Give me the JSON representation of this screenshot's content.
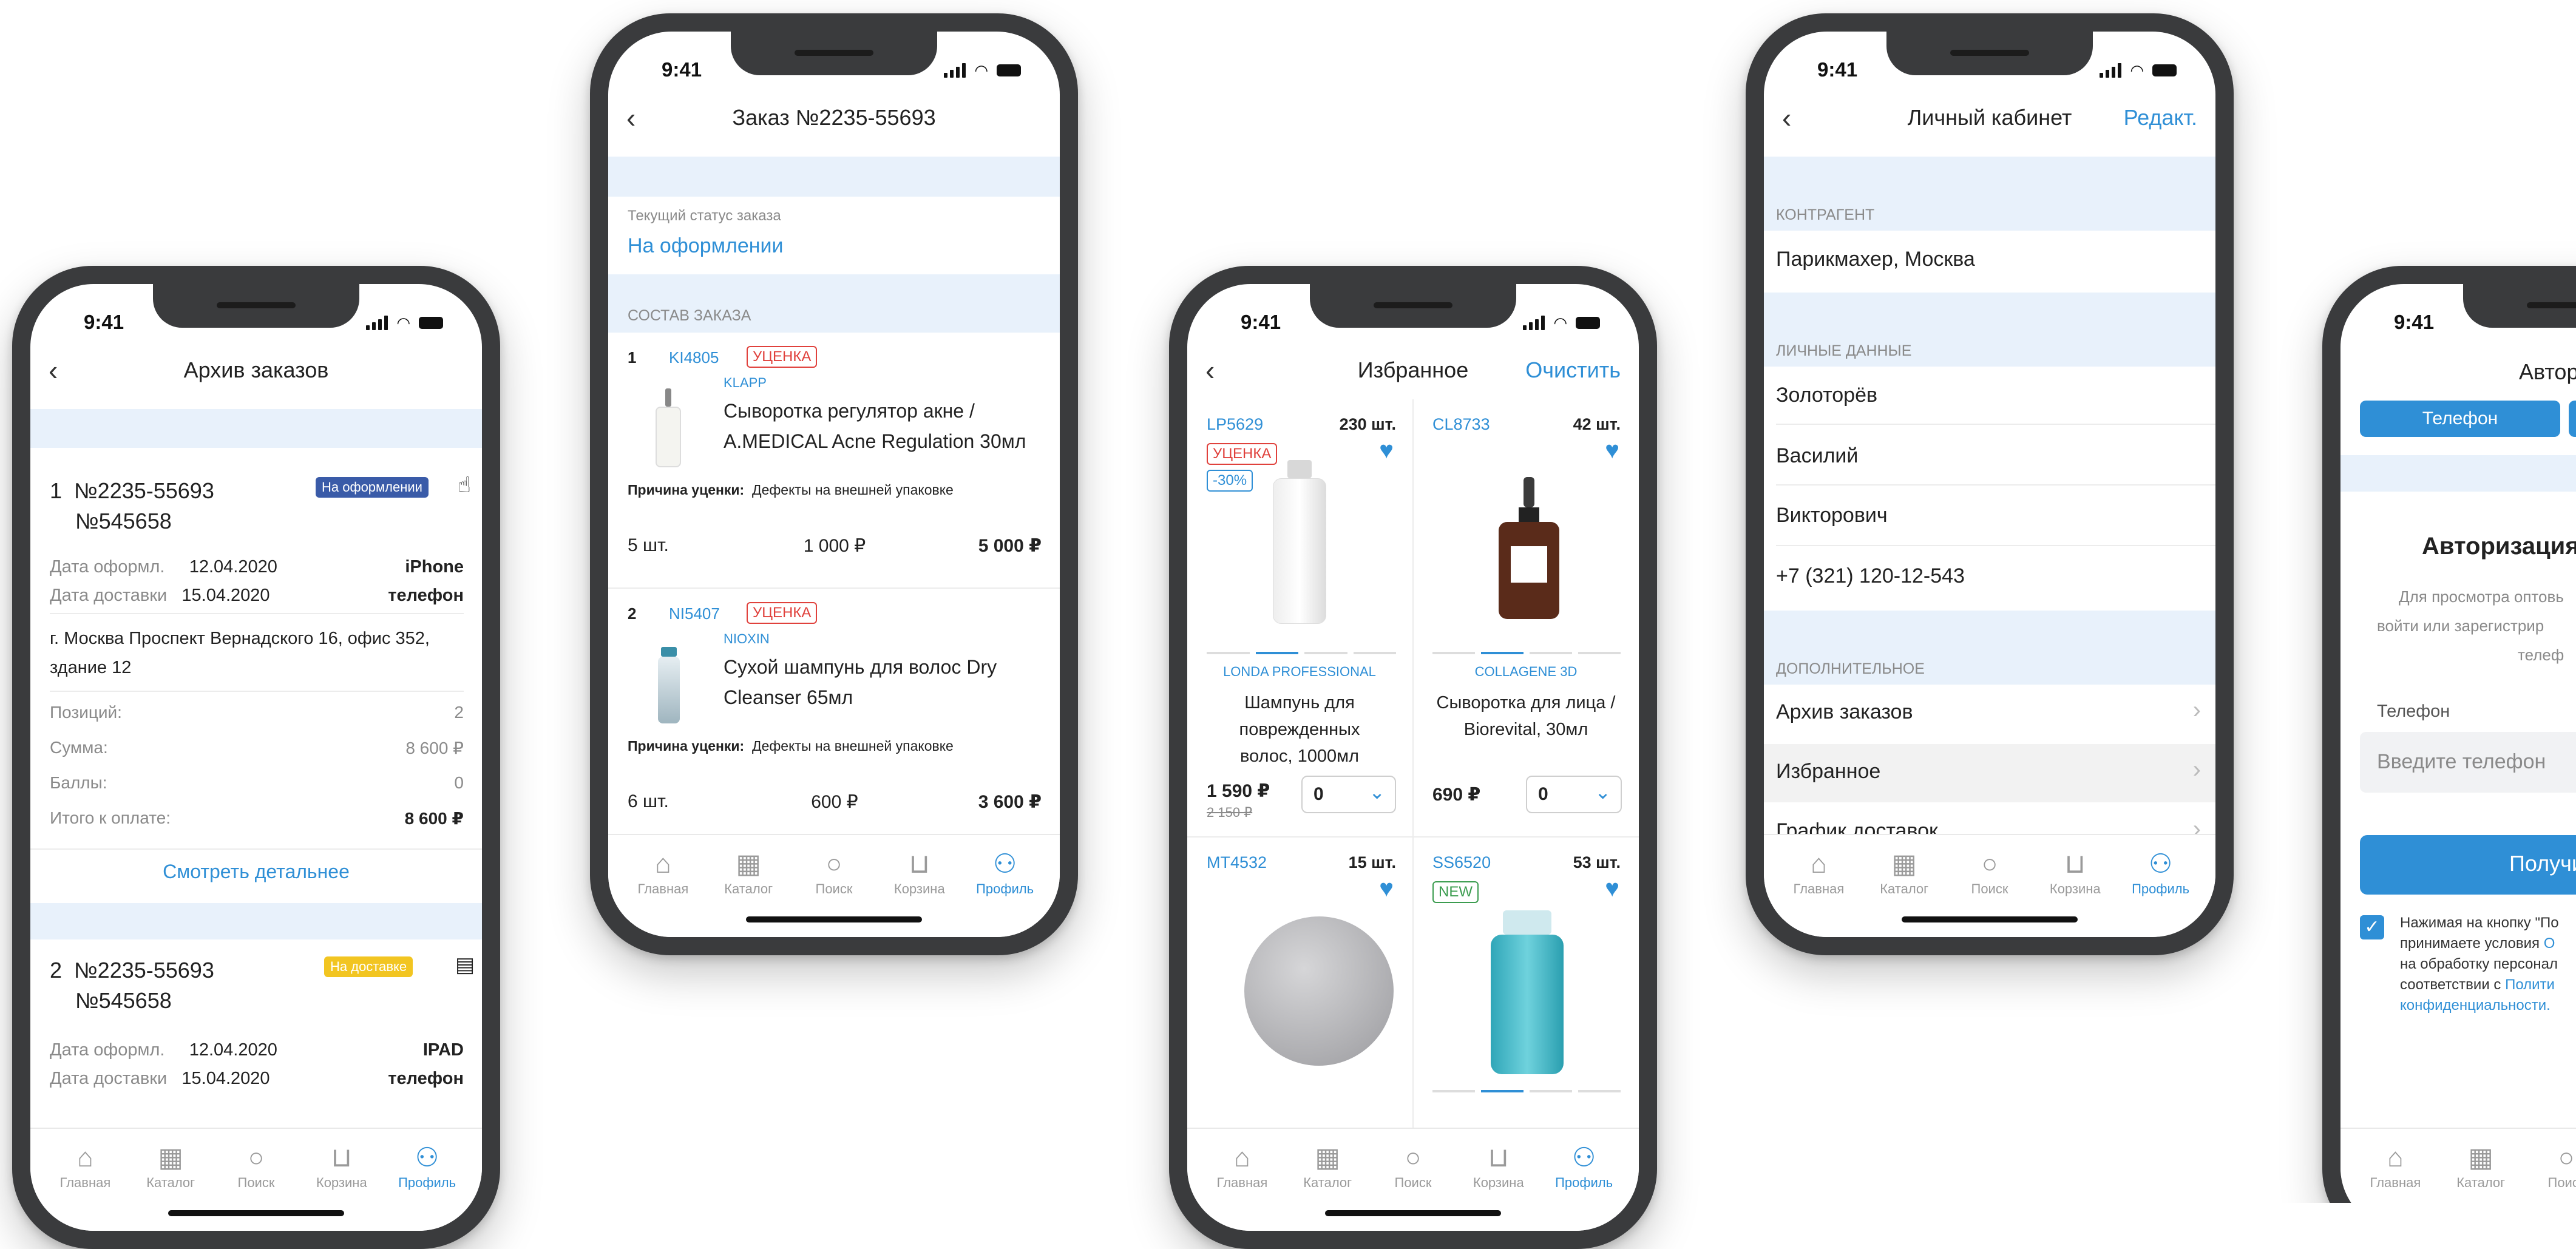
{
  "common": {
    "time": "9:41",
    "tabs": [
      "Главная",
      "Каталог",
      "Поиск",
      "Корзина",
      "Профиль"
    ],
    "tab_icons": [
      "home-icon",
      "grid-icon",
      "search-icon",
      "cart-icon",
      "profile-icon"
    ]
  },
  "archive": {
    "title": "Архив заказов",
    "order1": {
      "num": "1",
      "order_no": "№2235-55693",
      "sub_no": "№545658",
      "status": "На оформлении",
      "date_label": "Дата оформл.",
      "date": "12.04.2020",
      "source": "iPhone",
      "delivery_label": "Дата доставки",
      "delivery_date": "15.04.2020",
      "delivery_type": "телефон",
      "address": "г. Москва Проспект Вернадского 16, офис 352, здание 12",
      "positions_label": "Позиций:",
      "positions": "2",
      "sum_label": "Сумма:",
      "sum": "8 600 ₽",
      "points_label": "Баллы:",
      "points": "0",
      "total_label": "Итого к оплате:",
      "total": "8 600 ₽",
      "details": "Смотреть детальнее"
    },
    "order2": {
      "num": "2",
      "order_no": "№2235-55693",
      "sub_no": "№545658",
      "status": "На доставке",
      "date_label": "Дата оформл.",
      "date": "12.04.2020",
      "source": "IPAD",
      "delivery_label": "Дата доставки",
      "delivery_date": "15.04.2020",
      "delivery_type": "телефон"
    },
    "colors": {
      "status1": "#3a5ba8",
      "status2": "#f2c521"
    }
  },
  "order": {
    "title": "Заказ №2235-55693",
    "status_label": "Текущий статус заказа",
    "status_value": "На оформлении",
    "section": "СОСТАВ ЗАКАЗА",
    "items": [
      {
        "num": "1",
        "sku": "KI4805",
        "tag": "УЦЕНКА",
        "brand": "KLAPP",
        "name": "Сыворотка регулятор акне / A.MEDICAL Acne Regulation 30мл",
        "reason_label": "Причина уценки:",
        "reason": "Дефекты на внешней упаковке",
        "qty": "5 шт.",
        "price": "1 000 ₽",
        "total": "5 000 ₽"
      },
      {
        "num": "2",
        "sku": "NI5407",
        "tag": "УЦЕНКА",
        "brand": "NIOXIN",
        "name": "Сухой шампунь для волос Dry Cleanser 65мл",
        "reason_label": "Причина уценки:",
        "reason": "Дефекты на внешней упаковке",
        "qty": "6 шт.",
        "price": "600 ₽",
        "total": "3 600 ₽"
      }
    ]
  },
  "favorites": {
    "title": "Избранное",
    "clear": "Очистить",
    "products": [
      {
        "sku": "LP5629",
        "stock": "230 шт.",
        "tag": "УЦЕНКА",
        "discount": "-30%",
        "brand": "LONDA PROFESSIONAL",
        "name": "Шампунь для поврежденных волос, 1000мл",
        "price": "1 590 ₽",
        "old_price": "2 150 ₽",
        "qty": "0"
      },
      {
        "sku": "CL8733",
        "stock": "42 шт.",
        "brand": "COLLAGENE 3D",
        "name": "Сыворотка для лица / Biorevital, 30мл",
        "price": "690 ₽",
        "qty": "0"
      },
      {
        "sku": "MT4532",
        "stock": "15 шт."
      },
      {
        "sku": "SS6520",
        "stock": "53 шт.",
        "tag": "NEW"
      }
    ]
  },
  "profile": {
    "title": "Личный кабинет",
    "edit": "Редакт.",
    "sections": {
      "contractor": "КОНТРАГЕНТ",
      "personal": "ЛИЧНЫЕ ДАННЫЕ",
      "additional": "ДОПОЛНИТЕЛЬНОЕ"
    },
    "contractor_value": "Парикмахер, Москва",
    "surname": "Золоторёв",
    "name": "Василий",
    "patronymic": "Викторович",
    "phone": "+7 (321) 120-12-543",
    "links": [
      "Архив заказов",
      "Избранное",
      "График доставок"
    ]
  },
  "auth": {
    "title": "Авториз",
    "seg_phone": "Телефон",
    "heading": "Авторизация/Р",
    "desc1": "Для просмотра оптовь",
    "desc2": "войти или зарегистрир",
    "desc3": "телеф",
    "phone_label": "Телефон",
    "phone_placeholder": "Введите телефон",
    "button": "Получит",
    "consent1": "Нажимая на кнопку \"По",
    "consent2a": "принимаете условия ",
    "consent2b": "О",
    "consent3": "на обработку персонал",
    "consent4a": "соответствии с ",
    "consent4b": "Полити",
    "consent5": "конфиденциальности."
  }
}
